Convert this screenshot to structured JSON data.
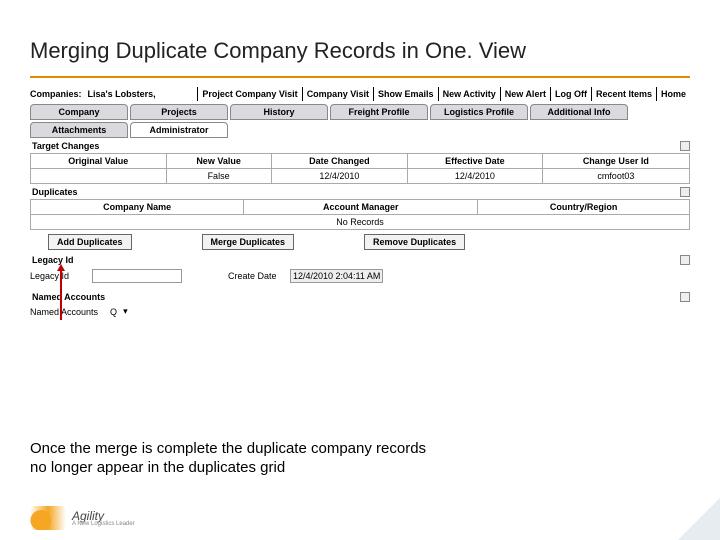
{
  "slide": {
    "title": "Merging Duplicate Company Records in One. View",
    "caption_line1": "Once the merge is complete the duplicate company records",
    "caption_line2": "no longer appear in the duplicates grid",
    "logo_name": "Agility",
    "logo_tagline": "A New Logistics Leader"
  },
  "app": {
    "header_label": "Companies:",
    "header_value": "Lisa's Lobsters,",
    "actions": [
      "Project Company Visit",
      "Company Visit",
      "Show Emails",
      "New Activity",
      "New Alert",
      "Log Off",
      "Recent Items",
      "Home"
    ],
    "tabs_row1": [
      "Company",
      "Projects",
      "History",
      "Freight Profile",
      "Logistics Profile",
      "Additional Info"
    ],
    "tabs_row2": [
      "Attachments",
      "Administrator"
    ],
    "active_tab": "Administrator"
  },
  "target_changes": {
    "label": "Target Changes",
    "cols": [
      "Original Value",
      "New Value",
      "Date Changed",
      "Effective Date",
      "Change User Id"
    ],
    "row": {
      "orig": "",
      "new": "False",
      "changed": "12/4/2010",
      "effective": "12/4/2010",
      "user": "cmfoot03"
    }
  },
  "duplicates": {
    "label": "Duplicates",
    "cols": [
      "Company Name",
      "Account Manager",
      "Country/Region"
    ],
    "norecords": "No Records",
    "buttons": {
      "add": "Add Duplicates",
      "merge": "Merge Duplicates",
      "remove": "Remove Duplicates"
    }
  },
  "legacy": {
    "label": "Legacy Id",
    "field_label": "Legacy Id",
    "create_label": "Create Date",
    "create_value": "12/4/2010 2:04:11 AM"
  },
  "named": {
    "label": "Named Accounts",
    "field_label": "Named Accounts",
    "q": "Q",
    "dd": "▾"
  }
}
